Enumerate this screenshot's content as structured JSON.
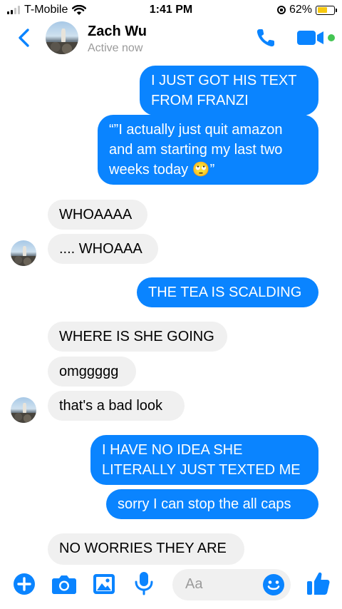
{
  "status_bar": {
    "carrier": "T-Mobile",
    "time": "1:41 PM",
    "battery_percent": "62%",
    "battery_level": 0.62,
    "icons": [
      "signal-icon",
      "wifi-icon",
      "orientation-lock-icon",
      "battery-icon"
    ]
  },
  "header": {
    "contact_name": "Zach Wu",
    "status": "Active now",
    "icons": [
      "back-chevron-icon",
      "avatar",
      "phone-icon",
      "video-camera-icon",
      "active-dot-icon"
    ]
  },
  "messages": [
    {
      "from": "me",
      "text": "I JUST GOT HIS TEXT FROM FRANZI"
    },
    {
      "from": "me",
      "text": "“”I actually just quit amazon and am starting my last two weeks today 🙄”"
    },
    {
      "from": "them",
      "text": "WHOAAAA"
    },
    {
      "from": "them",
      "text": ".... WHOAAA"
    },
    {
      "from": "me",
      "text": "THE TEA IS SCALDING"
    },
    {
      "from": "them",
      "text": "WHERE IS SHE GOING"
    },
    {
      "from": "them",
      "text": "omggggg"
    },
    {
      "from": "them",
      "text": "that's a bad look"
    },
    {
      "from": "me",
      "text": "I HAVE NO IDEA SHE LITERALLY JUST TEXTED ME"
    },
    {
      "from": "me",
      "text": "sorry I can stop the all caps"
    },
    {
      "from": "them",
      "text": "NO WORRIES THEY ARE"
    }
  ],
  "composer": {
    "placeholder": "Aa",
    "icons": [
      "plus-icon",
      "camera-icon",
      "image-icon",
      "microphone-icon",
      "emoji-icon",
      "thumbs-up-icon"
    ]
  },
  "colors": {
    "accent": "#0a84ff",
    "received_bubble": "#f0f0f0",
    "active_dot": "#44c553"
  }
}
